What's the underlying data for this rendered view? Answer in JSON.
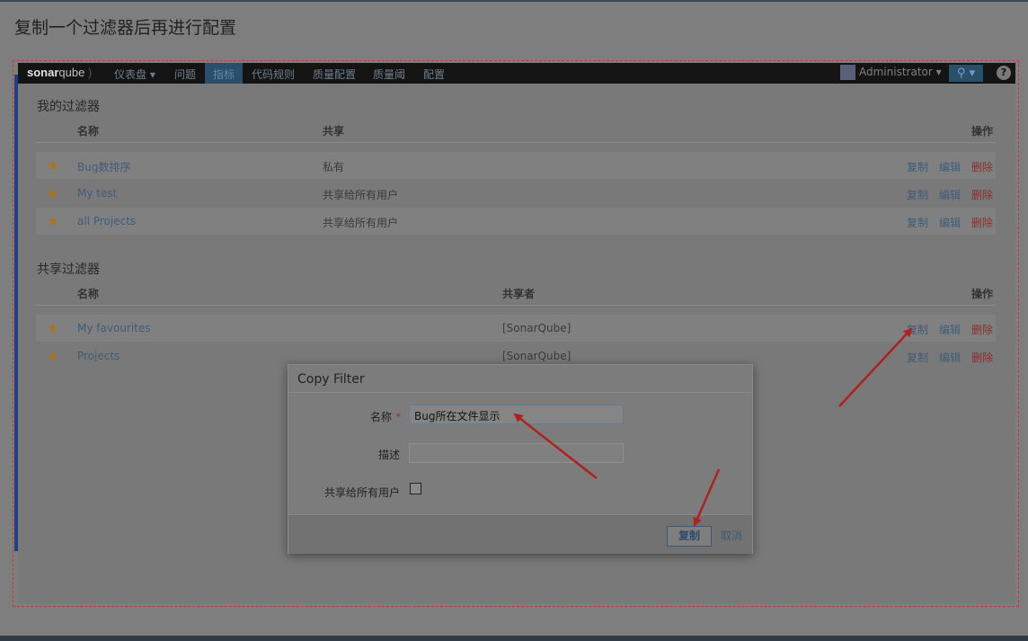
{
  "page_title": "复制一个过滤器后再进行配置",
  "navbar": {
    "brand_main": "sonar",
    "brand_sub": "qube",
    "items": [
      "仪表盘 ▾",
      "问题",
      "指标",
      "代码规则",
      "质量配置",
      "质量阈",
      "配置"
    ],
    "active_index": 2,
    "user": "Administrator ▾",
    "search_icon": "search-icon",
    "help": "?"
  },
  "my_filters": {
    "title": "我的过滤器",
    "columns": {
      "name": "名称",
      "share": "共享",
      "actions": "操作"
    },
    "rows": [
      {
        "name": "Bug数排序",
        "share": "私有"
      },
      {
        "name": "My test",
        "share": "共享给所有用户"
      },
      {
        "name": "all Projects",
        "share": "共享给所有用户"
      }
    ]
  },
  "shared_filters": {
    "title": "共享过滤器",
    "columns": {
      "name": "名称",
      "sharer": "共享者",
      "actions": "操作"
    },
    "rows": [
      {
        "name": "My favourites",
        "sharer": "[SonarQube]"
      },
      {
        "name": "Projects",
        "sharer": "[SonarQube]"
      }
    ]
  },
  "actions": {
    "copy": "复制",
    "edit": "编辑",
    "delete": "删除"
  },
  "modal": {
    "title": "Copy Filter",
    "name_label": "名称",
    "required_mark": "*",
    "name_value": "Bug所在文件显示",
    "desc_label": "描述",
    "desc_value": "",
    "share_label": "共享给所有用户",
    "share_checked": false,
    "copy_button": "复制",
    "cancel": "取消"
  },
  "colors": {
    "overlay": "#7e7e7e",
    "navbar": "#141414",
    "link": "#3f5c78",
    "delete": "#8a2e2e",
    "star": "#a8741c",
    "arrow": "#b02020"
  }
}
